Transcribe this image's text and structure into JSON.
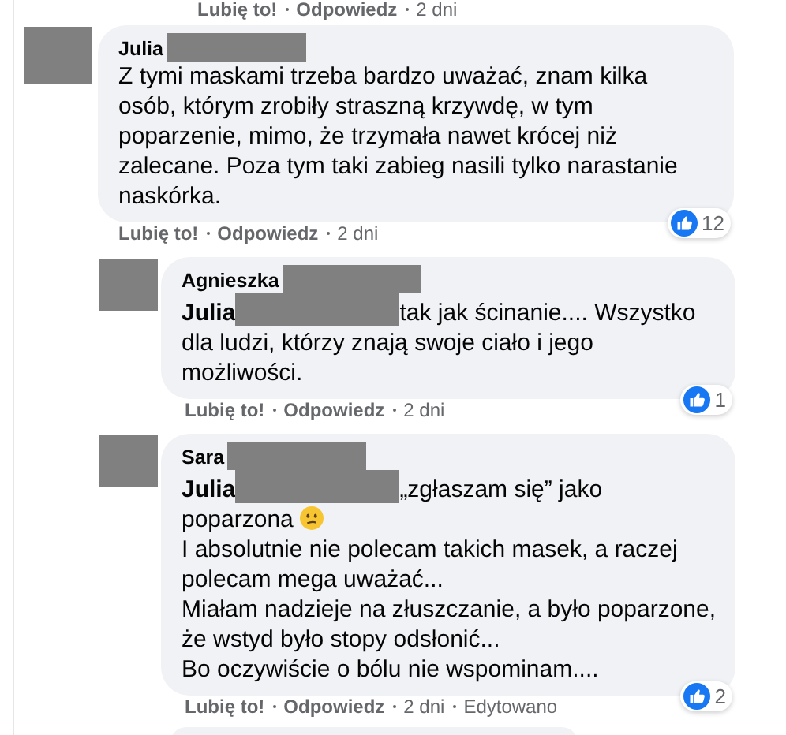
{
  "top_meta": [
    {
      "kind": "action",
      "text": "Lubię to!"
    },
    {
      "kind": "action",
      "text": "Odpowiedz"
    },
    {
      "kind": "info",
      "text": "2 dni"
    }
  ],
  "comments": [
    {
      "author": "Julia",
      "paragraphs": [
        [
          {
            "kind": "text",
            "text": "Z tymi maskami trzeba bardzo uważać, znam kilka osób, którym zrobiły straszną krzywdę, w tym poparzenie, mimo, że trzymała nawet krócej niż zalecane. Poza tym taki zabieg nasili tylko narastanie naskórka."
          }
        ]
      ],
      "reactions": "12",
      "meta": [
        {
          "kind": "action",
          "text": "Lubię to!"
        },
        {
          "kind": "action",
          "text": "Odpowiedz"
        },
        {
          "kind": "info",
          "text": "2 dni"
        }
      ],
      "children": [
        {
          "author": "Agnieszka",
          "paragraphs": [
            [
              {
                "kind": "mention",
                "text": "Julia"
              },
              {
                "kind": "text",
                "text": "tak jak ścinanie.... Wszystko dla ludzi, którzy znają swoje ciało i jego możliwości."
              }
            ]
          ],
          "reactions": "1",
          "meta": [
            {
              "kind": "action",
              "text": "Lubię to!"
            },
            {
              "kind": "action",
              "text": "Odpowiedz"
            },
            {
              "kind": "info",
              "text": "2 dni"
            }
          ]
        },
        {
          "author": "Sara",
          "paragraphs": [
            [
              {
                "kind": "mention",
                "text": "Julia"
              },
              {
                "kind": "text",
                "text": "„zgłaszam się” jako poparzona"
              },
              {
                "kind": "emoji"
              }
            ],
            [
              {
                "kind": "text",
                "text": "I absolutnie nie polecam takich masek, a raczej polecam mega uważać..."
              }
            ],
            [
              {
                "kind": "text",
                "text": "Miałam nadzieje na złuszczanie, a było poparzone, że wstyd było stopy odsłonić..."
              }
            ],
            [
              {
                "kind": "text",
                "text": "Bo oczywiście o bólu nie wspominam...."
              }
            ]
          ],
          "reactions": "2",
          "meta": [
            {
              "kind": "action",
              "text": "Lubię to!"
            },
            {
              "kind": "action",
              "text": "Odpowiedz"
            },
            {
              "kind": "info",
              "text": "2 dni"
            },
            {
              "kind": "info",
              "text": "Edytowano"
            }
          ]
        }
      ]
    }
  ]
}
